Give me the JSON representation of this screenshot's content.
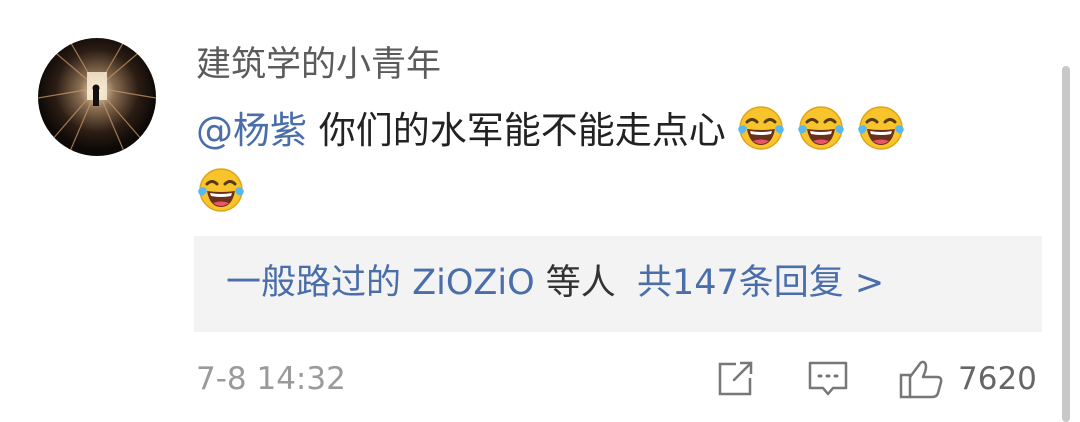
{
  "comment": {
    "username": "建筑学的小青年",
    "mention": "@杨紫",
    "text": "你们的水军能不能走点心",
    "emoji": "laughing-tears-emoji"
  },
  "replies": {
    "users": "一般路过的 ZiOZiO",
    "connector": "等人",
    "count_text": "共147条回复 >"
  },
  "footer": {
    "timestamp": "7-8 14:32",
    "like_count": "7620"
  },
  "colors": {
    "link": "#4a6ea9",
    "text": "#222222",
    "meta": "#9a9a9a",
    "reply_bg": "#f3f3f4"
  }
}
